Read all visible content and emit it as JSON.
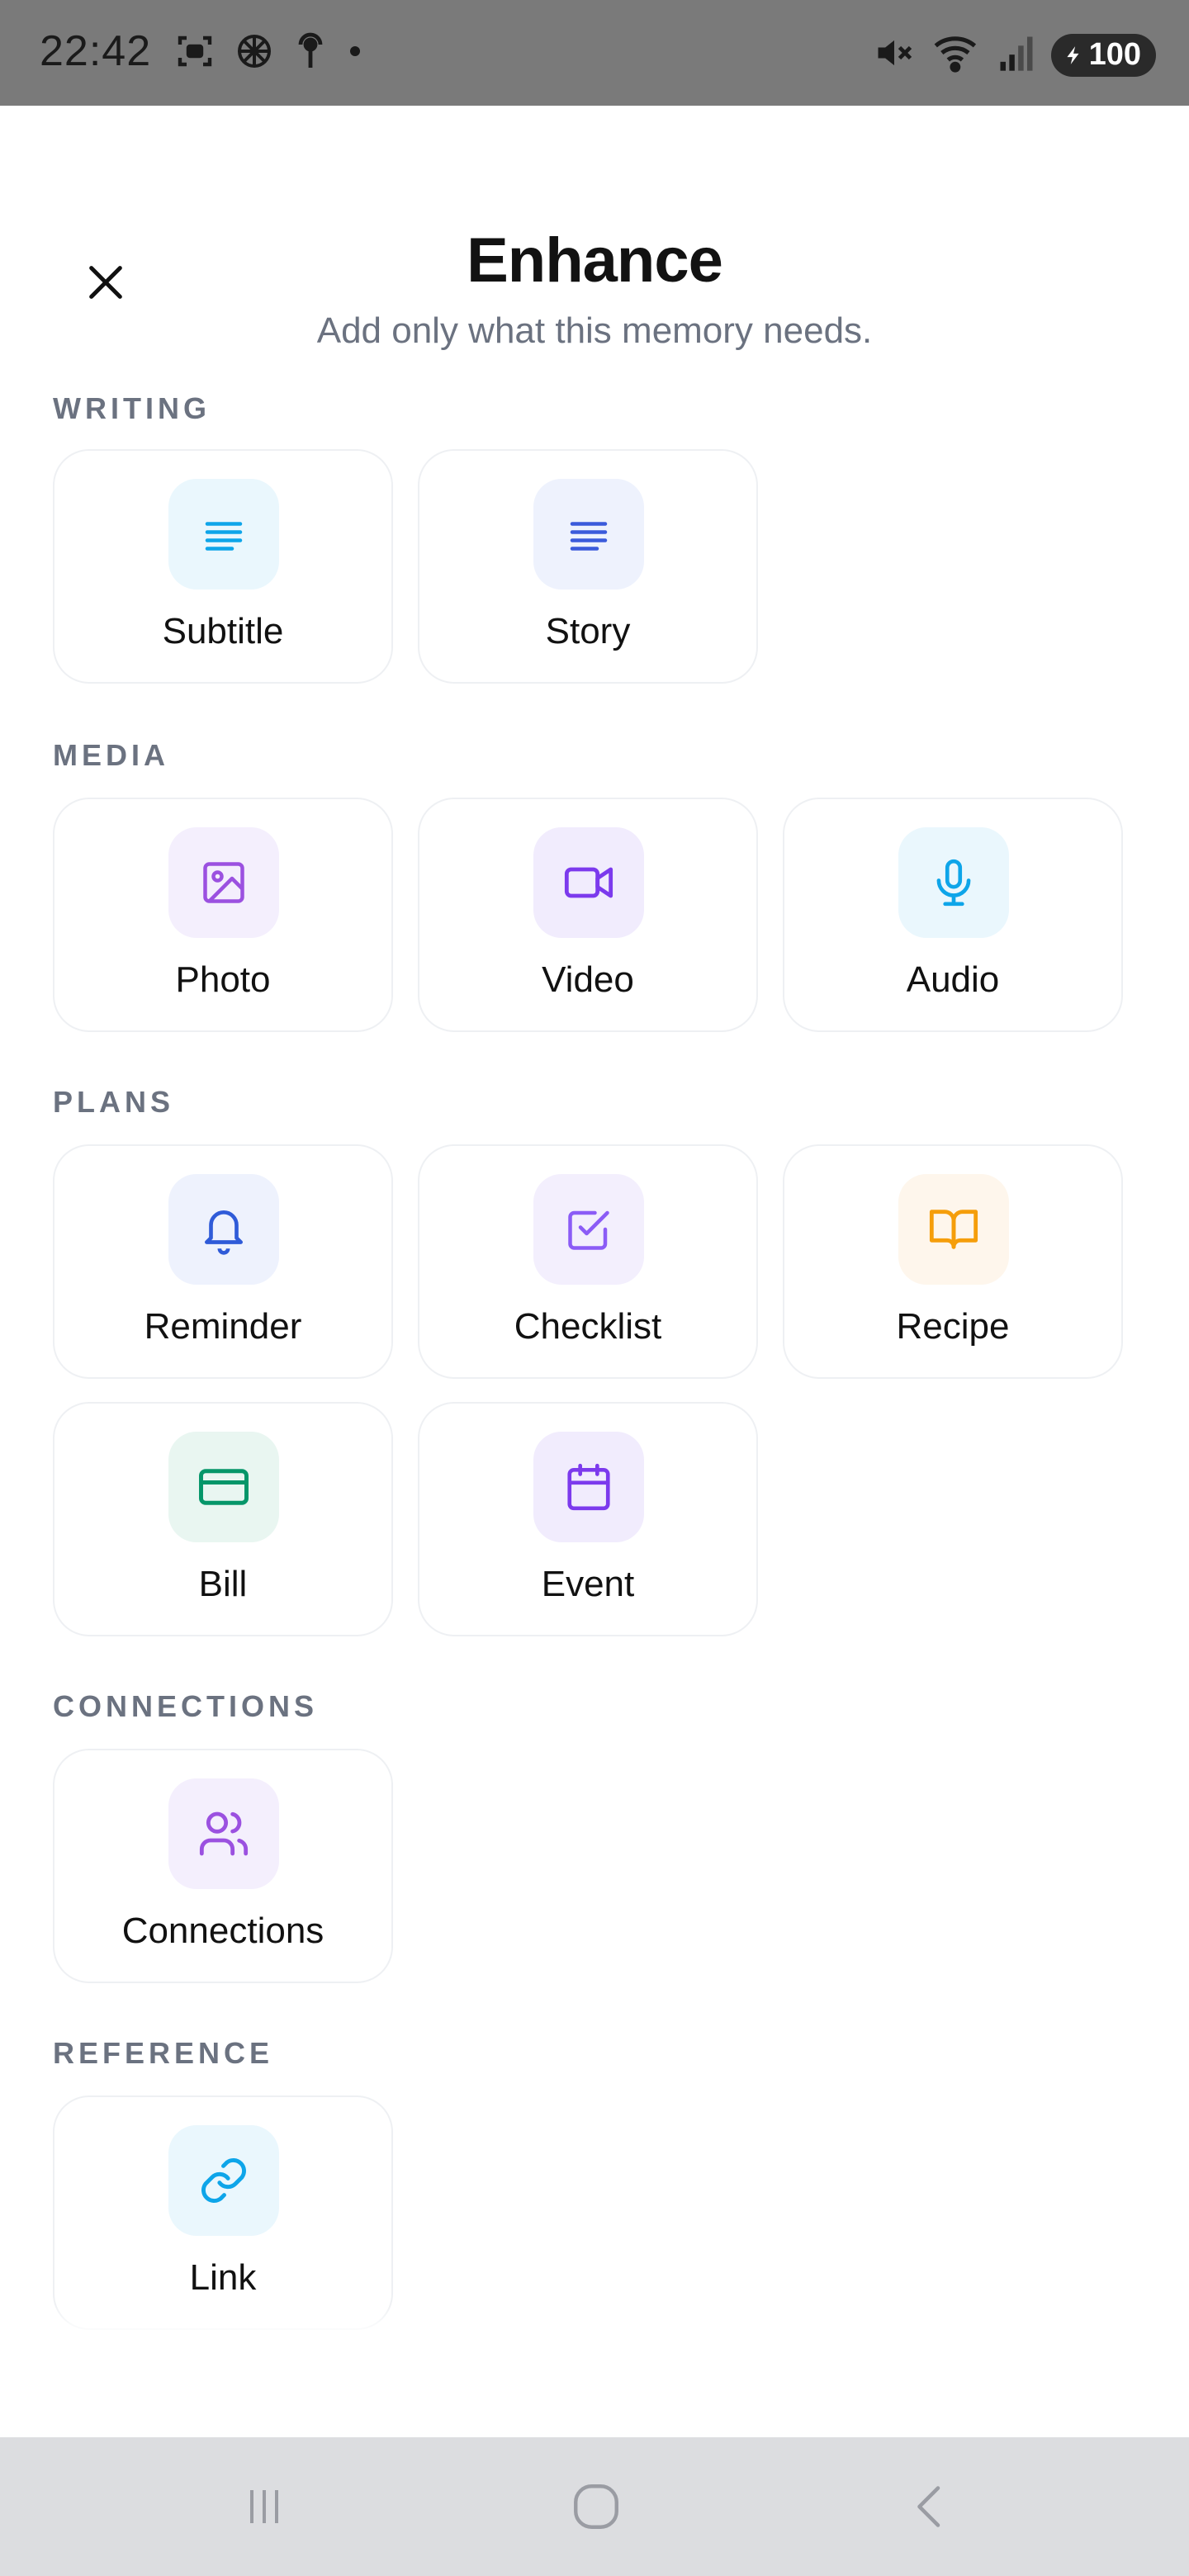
{
  "status_bar": {
    "time": "22:42",
    "battery": "100",
    "icons": [
      "screenshot-icon",
      "app-icon",
      "hotspot-icon",
      "dot-icon",
      "mute-icon",
      "wifi-icon",
      "signal-icon",
      "battery-icon"
    ]
  },
  "header": {
    "title": "Enhance",
    "subtitle": "Add only what this memory needs."
  },
  "sections": {
    "writing": {
      "label": "WRITING",
      "items": [
        {
          "label": "Subtitle",
          "icon": "text-lines-icon",
          "color": "#0ea5e9",
          "bg": "#eaf7fd"
        },
        {
          "label": "Story",
          "icon": "text-lines-icon",
          "color": "#3b5bdb",
          "bg": "#eef2fd"
        }
      ]
    },
    "media": {
      "label": "MEDIA",
      "items": [
        {
          "label": "Photo",
          "icon": "image-icon",
          "color": "#9b51e0",
          "bg": "#f4effd"
        },
        {
          "label": "Video",
          "icon": "video-camera-icon",
          "color": "#7c3aed",
          "bg": "#f1ecfd"
        },
        {
          "label": "Audio",
          "icon": "microphone-icon",
          "color": "#0ea5e9",
          "bg": "#eaf7fd"
        }
      ]
    },
    "plans": {
      "label": "PLANS",
      "items": [
        {
          "label": "Reminder",
          "icon": "bell-icon",
          "color": "#2f5bd8",
          "bg": "#eef2fd"
        },
        {
          "label": "Checklist",
          "icon": "checkbox-icon",
          "color": "#8b5cf6",
          "bg": "#f3effd"
        },
        {
          "label": "Recipe",
          "icon": "open-book-icon",
          "color": "#f59e0b",
          "bg": "#fef6ec"
        },
        {
          "label": "Bill",
          "icon": "credit-card-icon",
          "color": "#059669",
          "bg": "#e9f6f1"
        },
        {
          "label": "Event",
          "icon": "calendar-icon",
          "color": "#7c3aed",
          "bg": "#f1ecfd"
        }
      ]
    },
    "connections": {
      "label": "CONNECTIONS",
      "items": [
        {
          "label": "Connections",
          "icon": "people-icon",
          "color": "#9b51e0",
          "bg": "#f4effd"
        }
      ]
    },
    "reference": {
      "label": "REFERENCE",
      "items": [
        {
          "label": "Link",
          "icon": "link-icon",
          "color": "#0ea5e9",
          "bg": "#eaf7fd"
        }
      ]
    }
  },
  "nav": {
    "buttons": [
      "recents-icon",
      "home-icon",
      "back-icon"
    ]
  }
}
